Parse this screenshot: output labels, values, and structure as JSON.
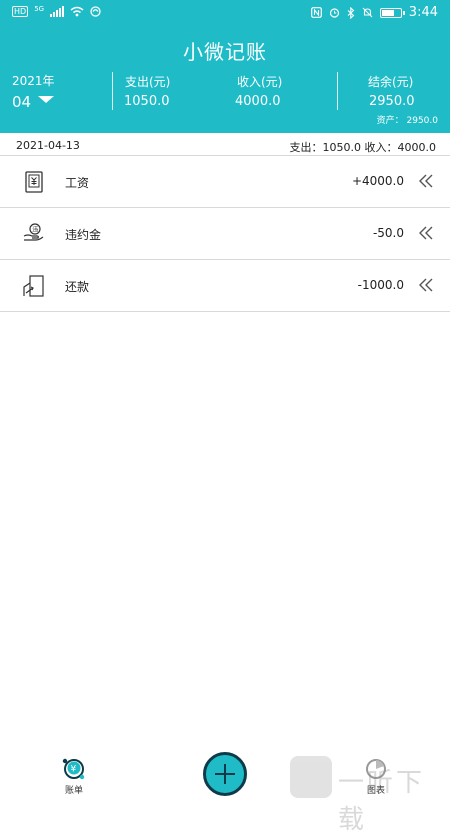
{
  "status_bar": {
    "hd": "HD",
    "network": "5G",
    "time": "3:44"
  },
  "header": {
    "title": "小微记账",
    "year": "2021年",
    "month": "04",
    "expense_label": "支出(元)",
    "expense_value": "1050.0",
    "income_label": "收入(元)",
    "income_value": "4000.0",
    "balance_label": "结余(元)",
    "balance_value": "2950.0",
    "assets": "资产： 2950.0"
  },
  "day_group": {
    "date": "2021-04-13",
    "summary": "支出：1050.0 收入：4000.0"
  },
  "records": [
    {
      "icon": "salary-icon",
      "name": "工资",
      "amount": "+4000.0"
    },
    {
      "icon": "penalty-icon",
      "name": "违约金",
      "amount": "-50.0"
    },
    {
      "icon": "repayment-icon",
      "name": "还款",
      "amount": "-1000.0"
    }
  ],
  "tabs": {
    "bills": "账单",
    "charts": "图表"
  },
  "watermark": "一听下载",
  "colors": {
    "accent": "#1fbcc7",
    "dark": "#0e3b49"
  }
}
